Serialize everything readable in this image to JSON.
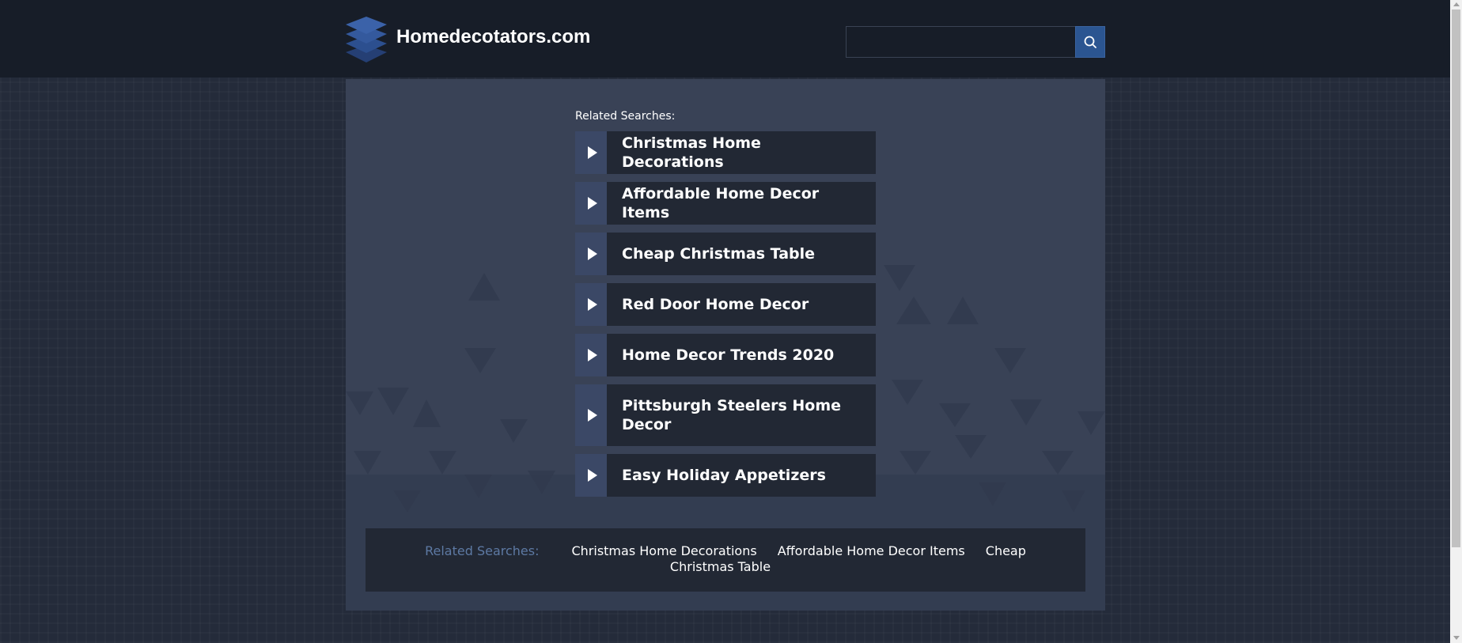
{
  "header": {
    "site_title": "Homedecotators.com",
    "logo_icon": "stacked-layers-icon",
    "search": {
      "placeholder": "",
      "value": "",
      "button_icon": "search-icon"
    }
  },
  "main": {
    "related_heading": "Related Searches:",
    "results": [
      {
        "label": "Christmas Home Decorations"
      },
      {
        "label": "Affordable Home Decor Items"
      },
      {
        "label": "Cheap Christmas Table"
      },
      {
        "label": "Red Door Home Decor"
      },
      {
        "label": "Home Decor Trends 2020"
      },
      {
        "label": "Pittsburgh Steelers Home Decor"
      },
      {
        "label": "Easy Holiday Appetizers"
      }
    ],
    "result_icon": "play-arrow-icon"
  },
  "footer": {
    "heading": "Related Searches:",
    "links": [
      {
        "label": "Christmas Home Decorations"
      },
      {
        "label": "Affordable Home Decor Items"
      },
      {
        "label": "Cheap Christmas Table"
      }
    ]
  },
  "colors": {
    "header_bg": "#171d28",
    "page_bg": "#242b3a",
    "panel_bg": "#394256",
    "item_bg": "#222834",
    "arrow_bg": "#3b4866",
    "accent": "#2b5591",
    "footer_heading": "#5d79a3"
  }
}
